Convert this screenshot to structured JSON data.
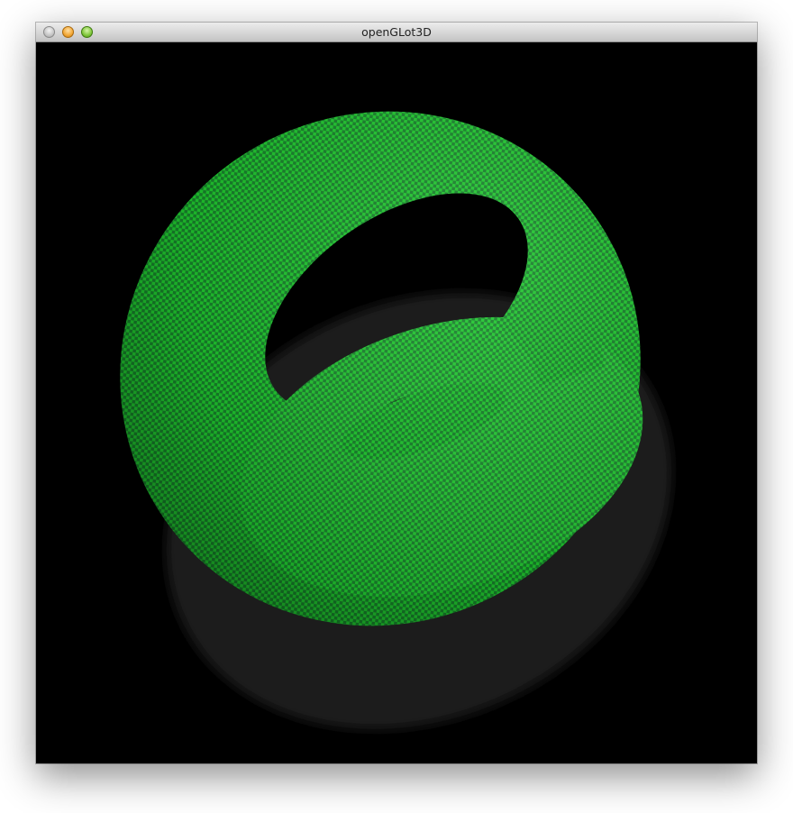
{
  "window": {
    "title": "openGLot3D"
  },
  "canvas": {
    "background": "#000000",
    "torus_color": "#1fc62e",
    "torus_stripe_color": "#17802a",
    "shadow_color": "#202020"
  }
}
